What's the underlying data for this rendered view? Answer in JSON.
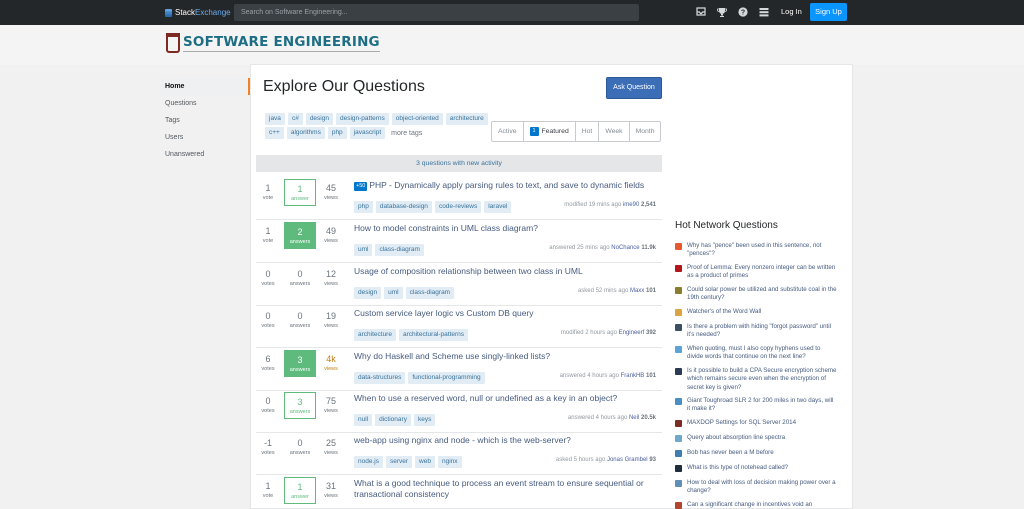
{
  "topbar": {
    "brand_a": "Stack",
    "brand_b": "Exchange",
    "search_placeholder": "Search on Software Engineering...",
    "login": "Log In",
    "signup": "Sign Up"
  },
  "site": {
    "logo_text": "SOFTWARE ENGINEERING"
  },
  "nav": [
    "Home",
    "Questions",
    "Tags",
    "Users",
    "Unanswered"
  ],
  "page": {
    "title": "Explore Our Questions",
    "ask_button": "Ask Question",
    "tags_row1": [
      "java",
      "c#",
      "design",
      "design-patterns",
      "object-oriented",
      "architecture"
    ],
    "tags_row2": [
      "c++",
      "algorithms",
      "php",
      "javascript"
    ],
    "more_tags": "more tags",
    "filters": {
      "active": "Active",
      "featured_count": "1",
      "featured": "Featured",
      "hot": "Hot",
      "week": "Week",
      "month": "Month"
    },
    "new_activity": "3 questions with new activity"
  },
  "questions": [
    {
      "votes": "1",
      "votes_label": "vote",
      "answers": "1",
      "answers_label": "answer",
      "answer_style": "bordered",
      "views": "45",
      "views_label": "views",
      "new_badge": "+50",
      "title": "PHP - Dynamically apply parsing rules to text, and save to dynamic fields",
      "tags": [
        "php",
        "database-design",
        "code-reviews",
        "laravel"
      ],
      "meta": "modified 19 mins ago",
      "user": "ime90",
      "rep": "2,541"
    },
    {
      "votes": "1",
      "votes_label": "vote",
      "answers": "2",
      "answers_label": "answers",
      "answer_style": "accepted",
      "views": "49",
      "views_label": "views",
      "title": "How to model constraints in UML class diagram?",
      "tags": [
        "uml",
        "class-diagram"
      ],
      "meta": "answered 25 mins ago",
      "user": "NoChance",
      "rep": "11.9k"
    },
    {
      "votes": "0",
      "votes_label": "votes",
      "answers": "0",
      "answers_label": "answers",
      "answer_style": "none",
      "views": "12",
      "views_label": "views",
      "title": "Usage of composition relationship between two class in UML",
      "tags": [
        "design",
        "uml",
        "class-diagram"
      ],
      "meta": "asked 52 mins ago",
      "user": "Maxx",
      "rep": "101"
    },
    {
      "votes": "0",
      "votes_label": "votes",
      "answers": "0",
      "answers_label": "answers",
      "answer_style": "none",
      "views": "19",
      "views_label": "views",
      "title": "Custom service layer logic vs Custom DB query",
      "tags": [
        "architecture",
        "architectural-patterns"
      ],
      "meta": "modified 2 hours ago",
      "user": "Engineerf",
      "rep": "392"
    },
    {
      "votes": "6",
      "votes_label": "votes",
      "answers": "3",
      "answers_label": "answers",
      "answer_style": "accepted",
      "views": "4k",
      "views_label": "views",
      "views_hot": true,
      "title": "Why do Haskell and Scheme use singly-linked lists?",
      "tags": [
        "data-structures",
        "functional-programming"
      ],
      "meta": "answered 4 hours ago",
      "user": "FrankHB",
      "rep": "101"
    },
    {
      "votes": "0",
      "votes_label": "votes",
      "answers": "3",
      "answers_label": "answers",
      "answer_style": "bordered",
      "views": "75",
      "views_label": "views",
      "title": "When to use a reserved word, null or undefined as a key in an object?",
      "tags": [
        "null",
        "dictionary",
        "keys"
      ],
      "meta": "answered 4 hours ago",
      "user": "Neil",
      "rep": "20.5k"
    },
    {
      "votes": "-1",
      "votes_label": "votes",
      "answers": "0",
      "answers_label": "answers",
      "answer_style": "none",
      "views": "25",
      "views_label": "views",
      "title": "web-app using nginx and node - which is the web-server?",
      "tags": [
        "node.js",
        "server",
        "web",
        "nginx"
      ],
      "meta": "asked 5 hours ago",
      "user": "Jonas Grambel",
      "rep": "93"
    },
    {
      "votes": "1",
      "votes_label": "vote",
      "answers": "1",
      "answers_label": "answer",
      "answer_style": "bordered",
      "views": "31",
      "views_label": "views",
      "title": "What is a good technique to process an event stream to ensure sequential or transactional consistency",
      "tags": [],
      "meta": "",
      "user": "",
      "rep": ""
    }
  ],
  "hot_network": {
    "title": "Hot Network Questions",
    "items": [
      {
        "text": "Why has \"pence\" been used in this sentence, not \"pences\"?",
        "color": "#e8592f"
      },
      {
        "text": "Proof of Lemma: Every nonzero integer can be written as a product of primes",
        "color": "#b4161b"
      },
      {
        "text": "Could solar power be utilized and substitute coal in the 19th century?",
        "color": "#8b7d2e"
      },
      {
        "text": "Watcher's of the Word Wall",
        "color": "#d9a441"
      },
      {
        "text": "Is there a problem with hiding \"forgot password\" until it's needed?",
        "color": "#3b4f62"
      },
      {
        "text": "When quoting, must I also copy hyphens used to divide words that continue on the next line?",
        "color": "#5aa3d6"
      },
      {
        "text": "Is it possible to build a CPA Secure encryption scheme which remains secure even when the encryption of secret key is given?",
        "color": "#2b3a55"
      },
      {
        "text": "Giant Toughroad SLR 2 for 200 miles in two days, will it make it?",
        "color": "#4a8fc4"
      },
      {
        "text": "MAXDOP Settings for SQL Server 2014",
        "color": "#7a2c25"
      },
      {
        "text": "Query about absorption line spectra",
        "color": "#6fa8c9"
      },
      {
        "text": "Bob has never been a M before",
        "color": "#3e7eb0"
      },
      {
        "text": "What is this type of notehead called?",
        "color": "#1f2d3d"
      },
      {
        "text": "How to deal with loss of decision making power over a change?",
        "color": "#5f8fb6"
      },
      {
        "text": "Can a significant change in incentives void an",
        "color": "#b3452e"
      }
    ]
  }
}
